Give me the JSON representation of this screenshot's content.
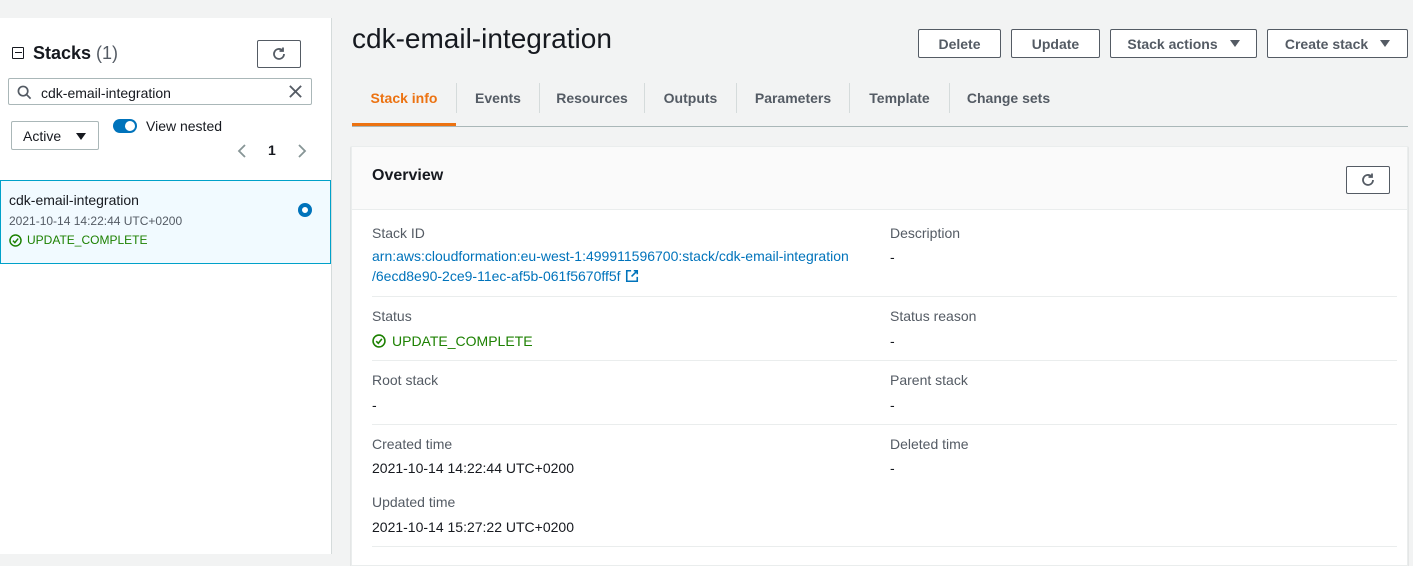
{
  "sidebar": {
    "title": "Stacks",
    "count": "(1)",
    "search_value": "cdk-email-integration",
    "filter_value": "Active",
    "toggle_label": "View nested",
    "page_number": "1",
    "stacks": [
      {
        "name": "cdk-email-integration",
        "time": "2021-10-14 14:22:44 UTC+0200",
        "status": "UPDATE_COMPLETE"
      }
    ]
  },
  "header": {
    "title": "cdk-email-integration",
    "buttons": {
      "delete": "Delete",
      "update": "Update",
      "stack_actions": "Stack actions",
      "create_stack": "Create stack"
    }
  },
  "tabs": [
    "Stack info",
    "Events",
    "Resources",
    "Outputs",
    "Parameters",
    "Template",
    "Change sets"
  ],
  "overview": {
    "title": "Overview",
    "stack_id_label": "Stack ID",
    "stack_id_line1": "arn:aws:cloudformation:eu-west-1:499911596700:stack/cdk-email-integration",
    "stack_id_line2": "/6ecd8e90-2ce9-11ec-af5b-061f5670ff5f",
    "description_label": "Description",
    "description_value": "-",
    "status_label": "Status",
    "status_value": "UPDATE_COMPLETE",
    "status_reason_label": "Status reason",
    "status_reason_value": "-",
    "root_stack_label": "Root stack",
    "root_stack_value": "-",
    "parent_stack_label": "Parent stack",
    "parent_stack_value": "-",
    "created_time_label": "Created time",
    "created_time_value": "2021-10-14 14:22:44 UTC+0200",
    "deleted_time_label": "Deleted time",
    "deleted_time_value": "-",
    "updated_time_label": "Updated time",
    "updated_time_value": "2021-10-14 15:27:22 UTC+0200"
  },
  "colors": {
    "accent": "#ec7211",
    "link": "#0073bb",
    "success": "#1d8102",
    "selected_border": "#00a1c9"
  },
  "icons": [
    "collapse-square-icon",
    "refresh-icon",
    "search-icon",
    "clear-icon",
    "caret-down-icon",
    "chevron-left-icon",
    "chevron-right-icon",
    "status-success-icon",
    "external-link-icon",
    "radio-selected-icon"
  ]
}
